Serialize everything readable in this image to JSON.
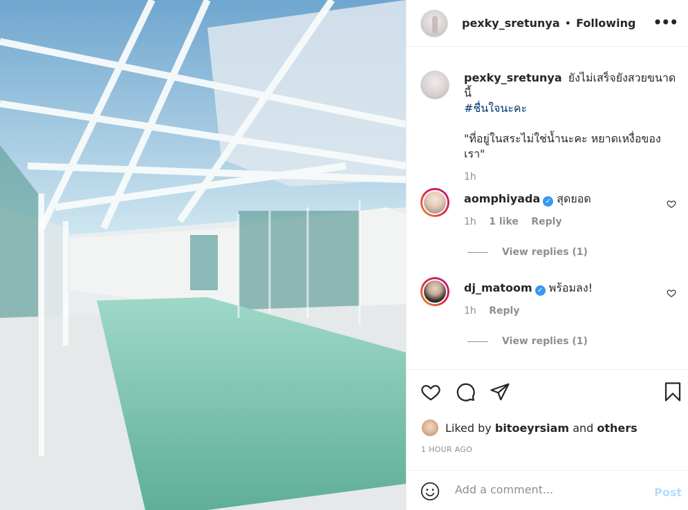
{
  "post": {
    "username": "pexky_sretunya",
    "follow_status": "Following",
    "caption_lines": [
      "ยังไม่เสร็จยังสวยขนาดนี้"
    ],
    "hashtag": "#ชื่นใจนะคะ",
    "quote": "\"ที่อยู่ในสระไม่ใช่น้ำนะคะ หยาดเหงื่อของเรา\"",
    "caption_time": "1h",
    "liked_by_label": "Liked by",
    "liked_by_user": "bitoeyrsiam",
    "liked_by_and": "and",
    "liked_by_others": "others",
    "posted_ago": "1 HOUR AGO"
  },
  "comments": [
    {
      "username": "aomphiyada",
      "verified": true,
      "text": "สุดยอด",
      "time": "1h",
      "likes": "1 like",
      "reply_label": "Reply",
      "view_replies": "View replies (1)"
    },
    {
      "username": "dj_matoom",
      "verified": true,
      "text": "พร้อมลง!",
      "time": "1h",
      "reply_label": "Reply",
      "view_replies": "View replies (1)"
    }
  ],
  "comment_box": {
    "placeholder": "Add a comment...",
    "post_label": "Post"
  },
  "icons": {
    "more": "more-icon",
    "like": "heart-icon",
    "comment": "comment-icon",
    "share": "share-icon",
    "save": "bookmark-icon",
    "emoji": "emoji-icon"
  },
  "colors": {
    "link": "#00376b",
    "verified": "#3897f0",
    "muted": "#8e8e8e",
    "post_disabled": "#b2dffc"
  }
}
